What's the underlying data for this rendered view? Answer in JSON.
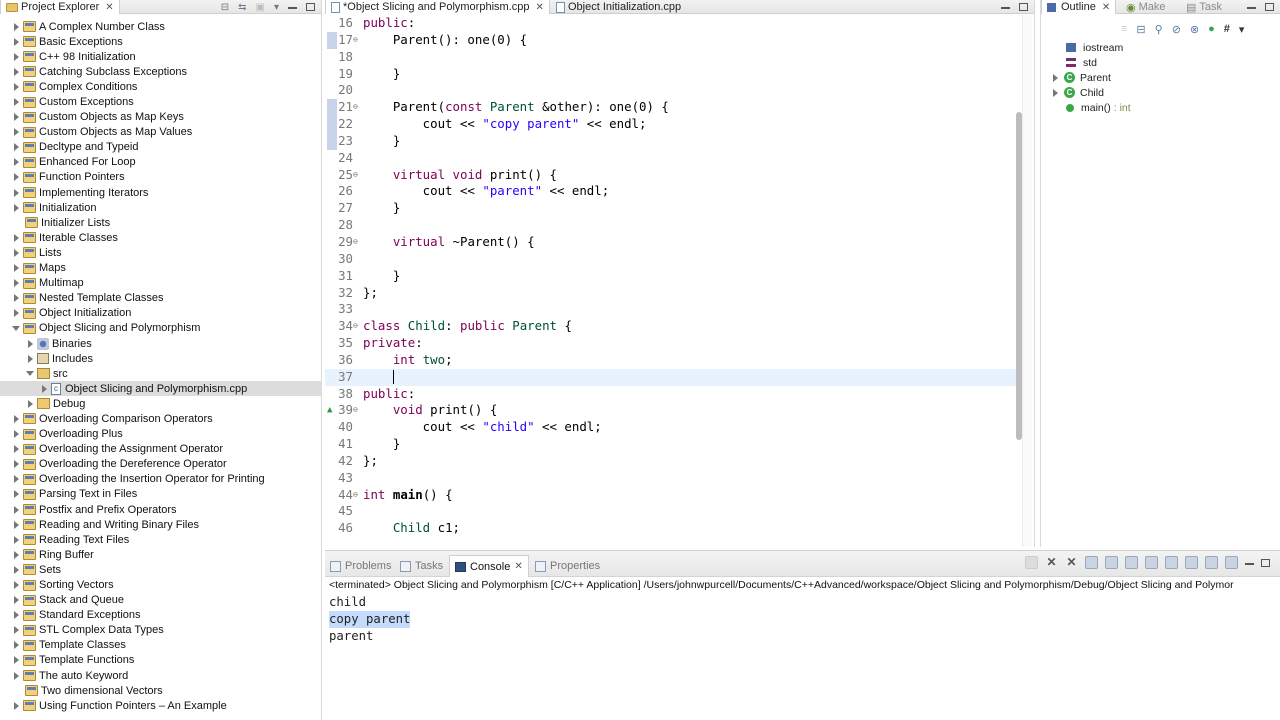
{
  "project_explorer": {
    "title": "Project Explorer",
    "items": [
      {
        "label": "A Complex Number Class",
        "level": 0,
        "twisty": "closed",
        "icon": "project"
      },
      {
        "label": "Basic Exceptions",
        "level": 0,
        "twisty": "closed",
        "icon": "project"
      },
      {
        "label": "C++ 98 Initialization",
        "level": 0,
        "twisty": "closed",
        "icon": "project"
      },
      {
        "label": "Catching Subclass Exceptions",
        "level": 0,
        "twisty": "closed",
        "icon": "project"
      },
      {
        "label": "Complex Conditions",
        "level": 0,
        "twisty": "closed",
        "icon": "project"
      },
      {
        "label": "Custom Exceptions",
        "level": 0,
        "twisty": "closed",
        "icon": "project"
      },
      {
        "label": "Custom Objects as Map Keys",
        "level": 0,
        "twisty": "closed",
        "icon": "project"
      },
      {
        "label": "Custom Objects as Map Values",
        "level": 0,
        "twisty": "closed",
        "icon": "project"
      },
      {
        "label": "Decltype and Typeid",
        "level": 0,
        "twisty": "closed",
        "icon": "project"
      },
      {
        "label": "Enhanced For Loop",
        "level": 0,
        "twisty": "closed",
        "icon": "project"
      },
      {
        "label": "Function Pointers",
        "level": 0,
        "twisty": "closed",
        "icon": "project"
      },
      {
        "label": "Implementing Iterators",
        "level": 0,
        "twisty": "closed",
        "icon": "project"
      },
      {
        "label": "Initialization",
        "level": 0,
        "twisty": "closed",
        "icon": "project"
      },
      {
        "label": "Initializer Lists",
        "level": 0,
        "twisty": "none",
        "icon": "project"
      },
      {
        "label": "Iterable Classes",
        "level": 0,
        "twisty": "closed",
        "icon": "project"
      },
      {
        "label": "Lists",
        "level": 0,
        "twisty": "closed",
        "icon": "project"
      },
      {
        "label": "Maps",
        "level": 0,
        "twisty": "closed",
        "icon": "project"
      },
      {
        "label": "Multimap",
        "level": 0,
        "twisty": "closed",
        "icon": "project"
      },
      {
        "label": "Nested Template Classes",
        "level": 0,
        "twisty": "closed",
        "icon": "project"
      },
      {
        "label": "Object Initialization",
        "level": 0,
        "twisty": "closed",
        "icon": "project"
      },
      {
        "label": "Object Slicing and Polymorphism",
        "level": 0,
        "twisty": "open",
        "icon": "project"
      },
      {
        "label": "Binaries",
        "level": 1,
        "twisty": "closed",
        "icon": "binaries"
      },
      {
        "label": "Includes",
        "level": 1,
        "twisty": "closed",
        "icon": "includes"
      },
      {
        "label": "src",
        "level": 1,
        "twisty": "open",
        "icon": "src"
      },
      {
        "label": "Object Slicing and Polymorphism.cpp",
        "level": 2,
        "twisty": "closed",
        "icon": "cpp",
        "selected": true
      },
      {
        "label": "Debug",
        "level": 1,
        "twisty": "closed",
        "icon": "debug"
      },
      {
        "label": "Overloading Comparison Operators",
        "level": 0,
        "twisty": "closed",
        "icon": "project"
      },
      {
        "label": "Overloading Plus",
        "level": 0,
        "twisty": "closed",
        "icon": "project"
      },
      {
        "label": "Overloading the Assignment Operator",
        "level": 0,
        "twisty": "closed",
        "icon": "project"
      },
      {
        "label": "Overloading the Dereference Operator",
        "level": 0,
        "twisty": "closed",
        "icon": "project"
      },
      {
        "label": "Overloading the Insertion Operator for Printing",
        "level": 0,
        "twisty": "closed",
        "icon": "project"
      },
      {
        "label": "Parsing Text in Files",
        "level": 0,
        "twisty": "closed",
        "icon": "project"
      },
      {
        "label": "Postfix and Prefix Operators",
        "level": 0,
        "twisty": "closed",
        "icon": "project"
      },
      {
        "label": "Reading and Writing Binary Files",
        "level": 0,
        "twisty": "closed",
        "icon": "project"
      },
      {
        "label": "Reading Text Files",
        "level": 0,
        "twisty": "closed",
        "icon": "project"
      },
      {
        "label": "Ring Buffer",
        "level": 0,
        "twisty": "closed",
        "icon": "project"
      },
      {
        "label": "Sets",
        "level": 0,
        "twisty": "closed",
        "icon": "project"
      },
      {
        "label": "Sorting Vectors",
        "level": 0,
        "twisty": "closed",
        "icon": "project"
      },
      {
        "label": "Stack and Queue",
        "level": 0,
        "twisty": "closed",
        "icon": "project"
      },
      {
        "label": "Standard Exceptions",
        "level": 0,
        "twisty": "closed",
        "icon": "project"
      },
      {
        "label": "STL Complex Data Types",
        "level": 0,
        "twisty": "closed",
        "icon": "project"
      },
      {
        "label": "Template Classes",
        "level": 0,
        "twisty": "closed",
        "icon": "project"
      },
      {
        "label": "Template Functions",
        "level": 0,
        "twisty": "closed",
        "icon": "project"
      },
      {
        "label": "The auto Keyword",
        "level": 0,
        "twisty": "closed",
        "icon": "project"
      },
      {
        "label": "Two dimensional Vectors",
        "level": 0,
        "twisty": "none",
        "icon": "project"
      },
      {
        "label": "Using Function Pointers – An Example",
        "level": 0,
        "twisty": "closed",
        "icon": "project"
      }
    ]
  },
  "editor": {
    "tabs": [
      {
        "label": "*Object Slicing and Polymorphism.cpp",
        "active": true
      },
      {
        "label": "Object Initialization.cpp",
        "active": false
      }
    ],
    "lines": [
      {
        "n": "16",
        "html": "<span class=\"kw\">public</span>:"
      },
      {
        "n": "17",
        "fold": "⊖",
        "mark": "blue",
        "html": "    Parent(): one(0) {"
      },
      {
        "n": "18",
        "html": ""
      },
      {
        "n": "19",
        "html": "    }"
      },
      {
        "n": "20",
        "html": ""
      },
      {
        "n": "21",
        "fold": "⊖",
        "mark": "blue",
        "html": "    Parent(<span class=\"kw\">const</span> <span class=\"ty\">Parent</span> &amp;other): one(0) {"
      },
      {
        "n": "22",
        "mark": "blue",
        "html": "        cout &lt;&lt; <span class=\"str\">\"copy parent\"</span> &lt;&lt; endl;"
      },
      {
        "n": "23",
        "mark": "blue",
        "html": "    }"
      },
      {
        "n": "24",
        "html": ""
      },
      {
        "n": "25",
        "fold": "⊖",
        "html": "    <span class=\"kw\">virtual</span> <span class=\"kw\">void</span> print() {"
      },
      {
        "n": "26",
        "html": "        cout &lt;&lt; <span class=\"str\">\"parent\"</span> &lt;&lt; endl;"
      },
      {
        "n": "27",
        "html": "    }"
      },
      {
        "n": "28",
        "html": ""
      },
      {
        "n": "29",
        "fold": "⊖",
        "html": "    <span class=\"kw\">virtual</span> ~Parent() {"
      },
      {
        "n": "30",
        "html": ""
      },
      {
        "n": "31",
        "html": "    }"
      },
      {
        "n": "32",
        "html": "};"
      },
      {
        "n": "33",
        "html": ""
      },
      {
        "n": "34",
        "fold": "⊖",
        "html": "<span class=\"kw\">class</span> <span class=\"ty\">Child</span>: <span class=\"kw\">public</span> <span class=\"ty\">Parent</span> {"
      },
      {
        "n": "35",
        "html": "<span class=\"kw\">private</span>:"
      },
      {
        "n": "36",
        "html": "    <span class=\"kw\">int</span> <span class=\"ty\">two</span>;"
      },
      {
        "n": "37",
        "current": true,
        "html": "    <span class=\"caret\"></span>"
      },
      {
        "n": "38",
        "html": "<span class=\"kw\">public</span>:"
      },
      {
        "n": "39",
        "fold": "⊖",
        "mark": "green",
        "html": "    <span class=\"kw\">void</span> print() {"
      },
      {
        "n": "40",
        "html": "        cout &lt;&lt; <span class=\"str\">\"child\"</span> &lt;&lt; endl;"
      },
      {
        "n": "41",
        "html": "    }"
      },
      {
        "n": "42",
        "html": "};"
      },
      {
        "n": "43",
        "html": ""
      },
      {
        "n": "44",
        "fold": "⊖",
        "html": "<span class=\"kw\">int</span> <span class=\"fn\">main</span>() {"
      },
      {
        "n": "45",
        "html": ""
      },
      {
        "n": "46",
        "html": "    <span class=\"ty\">Child</span> c1;"
      }
    ]
  },
  "outline": {
    "tabs": [
      {
        "label": "Outline",
        "active": true
      },
      {
        "label": "Make",
        "active": false
      },
      {
        "label": "Task",
        "active": false
      }
    ],
    "items": [
      {
        "label": "iostream",
        "icon": "library",
        "twisty": "none"
      },
      {
        "label": "std",
        "icon": "namespace",
        "twisty": "none"
      },
      {
        "label": "Parent",
        "icon": "class",
        "twisty": "closed"
      },
      {
        "label": "Child",
        "icon": "class",
        "twisty": "closed"
      },
      {
        "label": "main()",
        "type": ": int",
        "icon": "function",
        "twisty": "none"
      }
    ]
  },
  "console": {
    "tabs": [
      "Problems",
      "Tasks",
      "Console",
      "Properties"
    ],
    "active_tab": "Console",
    "status": "<terminated> Object Slicing and Polymorphism [C/C++ Application] /Users/johnwpurcell/Documents/C++Advanced/workspace/Object Slicing and Polymorphism/Debug/Object Slicing and Polymor",
    "output": [
      {
        "text": "child",
        "highlight": false
      },
      {
        "text": "copy parent",
        "highlight": true
      },
      {
        "text": "parent",
        "highlight": false
      }
    ]
  },
  "colors": {
    "keyword": "#7f0055",
    "string": "#2a00ff",
    "type": "#005032",
    "current_line": "#e8f2fe",
    "selection": "#c4dbfb"
  }
}
